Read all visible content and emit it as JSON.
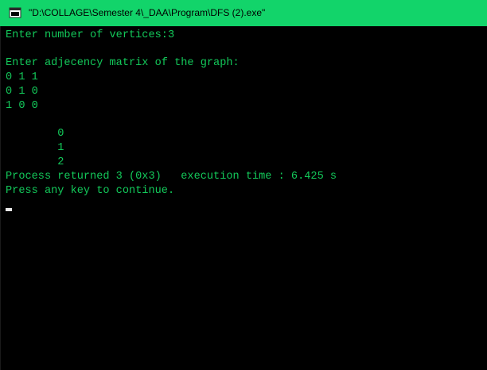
{
  "window": {
    "title": "\"D:\\COLLAGE\\Semester 4\\_DAA\\Program\\DFS (2).exe\"",
    "accent_color": "#12d46a",
    "text_color": "#13c95a",
    "background_color": "#000000",
    "icon": "console-app-icon"
  },
  "console": {
    "lines": [
      "Enter number of vertices:3",
      "Enter adjecency matrix of the graph:",
      "0 1 1",
      "0 1 0",
      "1 0 0",
      "        0",
      "        1",
      "        2",
      "Process returned 3 (0x3)   execution time : 6.425 s",
      "Press any key to continue."
    ]
  }
}
